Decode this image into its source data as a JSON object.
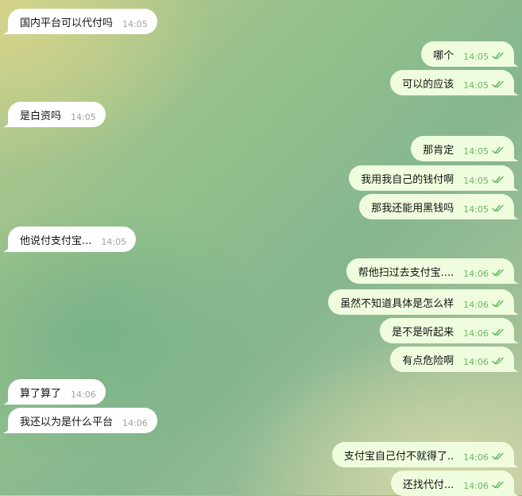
{
  "messages": [
    {
      "dir": "in",
      "text": "国内平台可以代付吗",
      "time": "14:05"
    },
    {
      "dir": "out",
      "text": "哪个",
      "time": "14:05"
    },
    {
      "dir": "out",
      "text": "可以的应该",
      "time": "14:05"
    },
    {
      "dir": "in",
      "text": "是白资吗",
      "time": "14:05"
    },
    {
      "dir": "out",
      "text": "那肯定",
      "time": "14:05"
    },
    {
      "dir": "out",
      "text": "我用我自己的钱付啊",
      "time": "14:05"
    },
    {
      "dir": "out",
      "text": "那我还能用黑钱吗",
      "time": "14:05"
    },
    {
      "dir": "in",
      "text": "他说付支付宝...",
      "time": "14:05"
    },
    {
      "dir": "out",
      "text": "帮他扫过去支付宝....",
      "time": "14:06"
    },
    {
      "dir": "out",
      "text": "虽然不知道具体是怎么样",
      "time": "14:06"
    },
    {
      "dir": "out",
      "text": "是不是听起来",
      "time": "14:06"
    },
    {
      "dir": "out",
      "text": "有点危险啊",
      "time": "14:06"
    },
    {
      "dir": "in",
      "text": "算了算了",
      "time": "14:06"
    },
    {
      "dir": "in",
      "text": "我还以为是什么平台",
      "time": "14:06"
    },
    {
      "dir": "out",
      "text": "支付宝自己付不就得了..",
      "time": "14:06"
    },
    {
      "dir": "out",
      "text": "还找代付...",
      "time": "14:06"
    }
  ],
  "colors": {
    "incoming_bubble": "#ffffff",
    "outgoing_bubble": "#effdde",
    "read_ticks": "#5fb65a"
  },
  "icons": {
    "read_status": "double-check-icon"
  }
}
